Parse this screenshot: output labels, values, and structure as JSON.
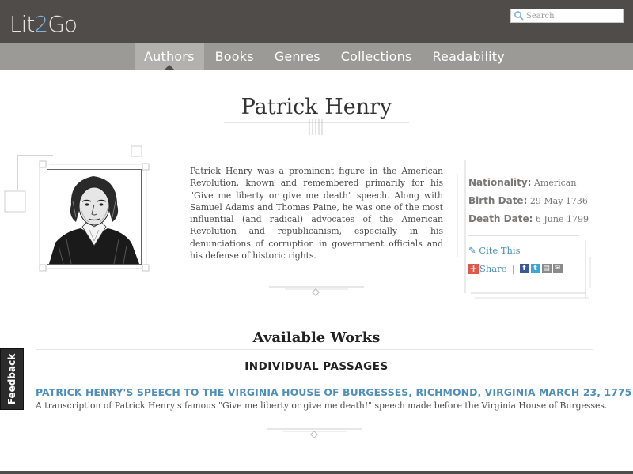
{
  "header": {
    "logo_part1": "Lit",
    "logo_part2": "2",
    "logo_part3": "Go",
    "search_placeholder": "Search"
  },
  "nav": {
    "items": [
      {
        "label": "Authors",
        "active": true
      },
      {
        "label": "Books"
      },
      {
        "label": "Genres"
      },
      {
        "label": "Collections"
      },
      {
        "label": "Readability"
      }
    ]
  },
  "author": {
    "name": "Patrick Henry",
    "bio": "Patrick Henry was a prominent figure in the American Revolution, known and remembered primarily for his \"Give me liberty or give me death\" speech. Along with Samuel Adams and Thomas Paine, he was one of the most influential (and radical) advocates of the American Revolution and republicanism, especially in his denunciations of corruption in government officials and his defense of historic rights.",
    "nationality_label": "Nationality:",
    "nationality": "American",
    "birth_label": "Birth Date:",
    "birth": "29 May 1736",
    "death_label": "Death Date:",
    "death": "6 June 1799",
    "cite_label": "Cite This",
    "share_label": "Share"
  },
  "works": {
    "title": "Available Works",
    "section_title": "INDIVIDUAL PASSAGES",
    "items": [
      {
        "title": "PATRICK HENRY'S SPEECH TO THE VIRGINIA HOUSE OF BURGESSES, RICHMOND, VIRGINIA MARCH 23, 1775",
        "description": "A transcription of Patrick Henry's famous \"Give me liberty or give me death!\" speech made before the Virginia House of Burgesses."
      }
    ]
  },
  "feedback_label": "Feedback",
  "colors": {
    "header_bg": "#4f4c4a",
    "nav_bg": "#9c9a97",
    "link": "#4f8fb8"
  }
}
